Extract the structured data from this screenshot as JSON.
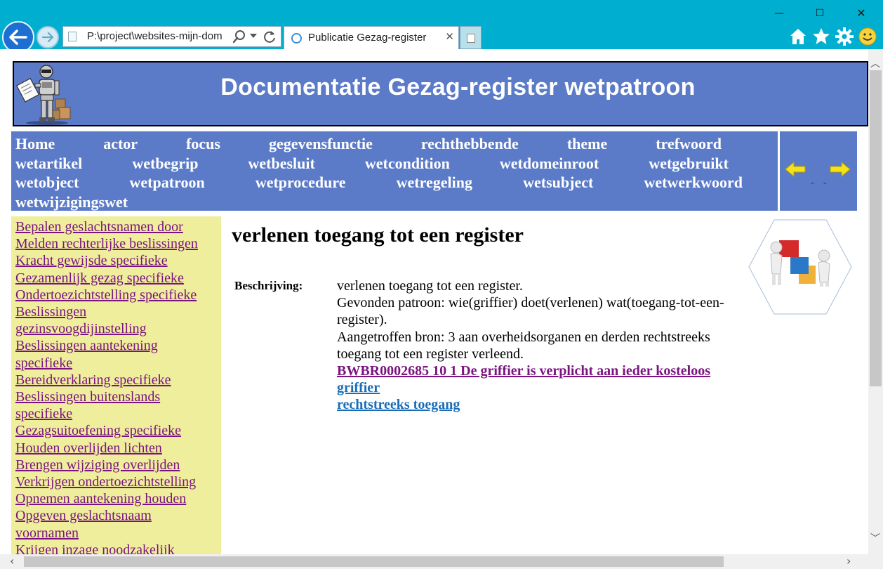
{
  "browser": {
    "address": "P:\\project\\websites-mijn-dom",
    "tab_title": "Publicatie Gezag-register",
    "window_min": "—",
    "window_max": "☐",
    "window_close": "✕",
    "tab_close": "✕"
  },
  "banner": {
    "title": "Documentatie Gezag-register wetpatroon"
  },
  "topnav": {
    "row1": [
      "Home",
      "actor",
      "focus",
      "gegevensfunctie",
      "rechthebbende",
      "theme",
      "trefwoord"
    ],
    "row2": [
      "wetartikel",
      "wetbegrip",
      "wetbesluit",
      "wetcondition",
      "wetdomeinroot",
      "wetgebruikt"
    ],
    "row3": [
      "wetobject",
      "wetpatroon",
      "wetprocedure",
      "wetregeling",
      "wetsubject",
      "wetwerkwoord"
    ],
    "row4": [
      "wetwijzigingswet"
    ]
  },
  "arrownav": {
    "prev_dash": "-",
    "next_dash": "-"
  },
  "sidebar": {
    "items": [
      "Bepalen geslachtsnamen door",
      "Melden rechterlijke beslissingen",
      "Kracht gewijsde specifieke",
      "Gezamenlijk gezag specifieke",
      "Ondertoezichtstelling specifieke",
      "Beslissingen gezinsvoogdijinstelling",
      "Beslissingen aantekening specifieke",
      "Bereidverklaring specifieke",
      "Beslissingen buitenslands specifieke",
      "Gezagsuitoefening specifieke",
      "Houden overlijden lichten",
      "Brengen wijziging overlijden",
      "Verkrijgen ondertoezichtstelling",
      "Opnemen aantekening houden",
      "Opgeven geslachtsnaam voornamen",
      "Krijgen inzage noodzakelijk"
    ]
  },
  "content": {
    "heading": "verlenen toegang tot een register",
    "desc_label": "Beschrijving:",
    "desc_line1": "verlenen toegang tot een register.",
    "desc_line2": "Gevonden patroon: wie(griffier) doet(verlenen) wat(toegang-tot-een-register).",
    "desc_line3": "Aangetroffen bron: 3 aan overheidsorganen en derden rechtstreeks toegang tot een register verleend.",
    "links": [
      "BWBR0002685 10 1 De griffier is verplicht aan ieder kosteloos",
      "griffier",
      "rechtstreeks toegang"
    ]
  },
  "colors": {
    "chrome": "#00afd0",
    "banner": "#5b7bc8",
    "sidebar": "#eeee9c",
    "visited_link": "#7b1480",
    "link": "#1a6eb8"
  }
}
